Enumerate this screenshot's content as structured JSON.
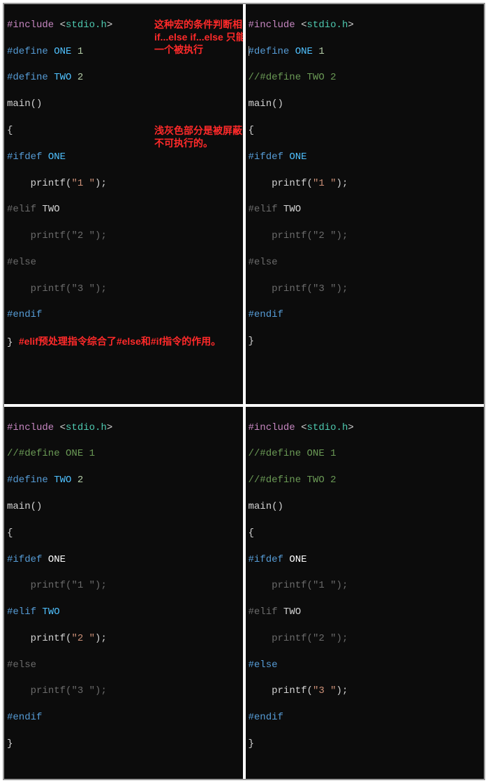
{
  "panels": {
    "p1": {
      "include": "#include",
      "lt": "<",
      "gt": ">",
      "hdr": "stdio.h",
      "def": "#define",
      "one": "ONE",
      "two": "TWO",
      "v1": "1",
      "v2": "2",
      "main": "main",
      "par": "()",
      "ob": "{",
      "cb": "}",
      "ifdef": "#ifdef",
      "elif": "#elif",
      "else": "#else",
      "endif": "#endif",
      "pf": "printf",
      "s1": "\"1 \"",
      "s2": "\"2 \"",
      "s3": "\"3 \"",
      "semi": ";",
      "lp": "(",
      "rp": ")",
      "ov1": "这种宏的条件判断相当于\nif...else if...else\n只能有一个被执行",
      "ov2": "浅灰色部分是被屏蔽的，不可执行的。"
    },
    "p2": {
      "include": "#include",
      "lt": "<",
      "gt": ">",
      "hdr": "stdio.h",
      "def": "#define",
      "one": "ONE",
      "two": "TWO",
      "v1": "1",
      "comment2": "//#define TWO 2",
      "main": "main",
      "par": "()",
      "ob": "{",
      "cb": "}",
      "ifdef": "#ifdef",
      "elif": "#elif",
      "else": "#else",
      "endif": "#endif",
      "pf": "printf",
      "s1": "\"1 \"",
      "s2": "\"2 \"",
      "s3": "\"3 \"",
      "semi": ";",
      "lp": "(",
      "rp": ")"
    },
    "p3": {
      "include": "#include",
      "lt": "<",
      "gt": ">",
      "hdr": "stdio.h",
      "def": "#define",
      "one": "ONE",
      "two": "TWO",
      "v2": "2",
      "comment1": "//#define ONE 1",
      "main": "main",
      "par": "()",
      "ob": "{",
      "cb": "}",
      "ifdef": "#ifdef",
      "elif": "#elif",
      "else": "#else",
      "endif": "#endif",
      "pf": "printf",
      "s1": "\"1 \"",
      "s2": "\"2 \"",
      "s3": "\"3 \"",
      "semi": ";",
      "lp": "(",
      "rp": ")"
    },
    "p4": {
      "include": "#include",
      "lt": "<",
      "gt": ">",
      "hdr": "stdio.h",
      "comment1": "//#define ONE 1",
      "comment2": "//#define TWO 2",
      "main": "main",
      "par": "()",
      "ob": "{",
      "cb": "}",
      "ifdef": "#ifdef",
      "one": "ONE",
      "elif": "#elif",
      "two": "TWO",
      "else": "#else",
      "endif": "#endif",
      "pf": "printf",
      "s1": "\"1 \"",
      "s2": "\"2 \"",
      "s3": "\"3 \"",
      "semi": ";",
      "lp": "(",
      "rp": ")"
    }
  },
  "caption": "#elif预处理指令综合了#else和#if指令的作用。"
}
